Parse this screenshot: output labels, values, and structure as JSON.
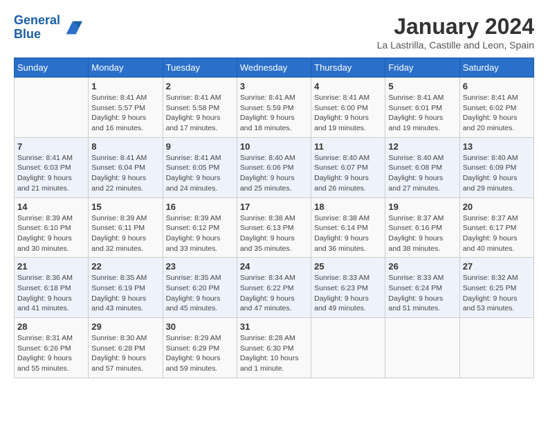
{
  "header": {
    "logo_line1": "General",
    "logo_line2": "Blue",
    "month_year": "January 2024",
    "location": "La Lastrilla, Castille and Leon, Spain"
  },
  "days_of_week": [
    "Sunday",
    "Monday",
    "Tuesday",
    "Wednesday",
    "Thursday",
    "Friday",
    "Saturday"
  ],
  "weeks": [
    [
      {
        "day": "",
        "sunrise": "",
        "sunset": "",
        "daylight": ""
      },
      {
        "day": "1",
        "sunrise": "Sunrise: 8:41 AM",
        "sunset": "Sunset: 5:57 PM",
        "daylight": "Daylight: 9 hours and 16 minutes."
      },
      {
        "day": "2",
        "sunrise": "Sunrise: 8:41 AM",
        "sunset": "Sunset: 5:58 PM",
        "daylight": "Daylight: 9 hours and 17 minutes."
      },
      {
        "day": "3",
        "sunrise": "Sunrise: 8:41 AM",
        "sunset": "Sunset: 5:59 PM",
        "daylight": "Daylight: 9 hours and 18 minutes."
      },
      {
        "day": "4",
        "sunrise": "Sunrise: 8:41 AM",
        "sunset": "Sunset: 6:00 PM",
        "daylight": "Daylight: 9 hours and 19 minutes."
      },
      {
        "day": "5",
        "sunrise": "Sunrise: 8:41 AM",
        "sunset": "Sunset: 6:01 PM",
        "daylight": "Daylight: 9 hours and 19 minutes."
      },
      {
        "day": "6",
        "sunrise": "Sunrise: 8:41 AM",
        "sunset": "Sunset: 6:02 PM",
        "daylight": "Daylight: 9 hours and 20 minutes."
      }
    ],
    [
      {
        "day": "7",
        "sunrise": "Sunrise: 8:41 AM",
        "sunset": "Sunset: 6:03 PM",
        "daylight": "Daylight: 9 hours and 21 minutes."
      },
      {
        "day": "8",
        "sunrise": "Sunrise: 8:41 AM",
        "sunset": "Sunset: 6:04 PM",
        "daylight": "Daylight: 9 hours and 22 minutes."
      },
      {
        "day": "9",
        "sunrise": "Sunrise: 8:41 AM",
        "sunset": "Sunset: 6:05 PM",
        "daylight": "Daylight: 9 hours and 24 minutes."
      },
      {
        "day": "10",
        "sunrise": "Sunrise: 8:40 AM",
        "sunset": "Sunset: 6:06 PM",
        "daylight": "Daylight: 9 hours and 25 minutes."
      },
      {
        "day": "11",
        "sunrise": "Sunrise: 8:40 AM",
        "sunset": "Sunset: 6:07 PM",
        "daylight": "Daylight: 9 hours and 26 minutes."
      },
      {
        "day": "12",
        "sunrise": "Sunrise: 8:40 AM",
        "sunset": "Sunset: 6:08 PM",
        "daylight": "Daylight: 9 hours and 27 minutes."
      },
      {
        "day": "13",
        "sunrise": "Sunrise: 8:40 AM",
        "sunset": "Sunset: 6:09 PM",
        "daylight": "Daylight: 9 hours and 29 minutes."
      }
    ],
    [
      {
        "day": "14",
        "sunrise": "Sunrise: 8:39 AM",
        "sunset": "Sunset: 6:10 PM",
        "daylight": "Daylight: 9 hours and 30 minutes."
      },
      {
        "day": "15",
        "sunrise": "Sunrise: 8:39 AM",
        "sunset": "Sunset: 6:11 PM",
        "daylight": "Daylight: 9 hours and 32 minutes."
      },
      {
        "day": "16",
        "sunrise": "Sunrise: 8:39 AM",
        "sunset": "Sunset: 6:12 PM",
        "daylight": "Daylight: 9 hours and 33 minutes."
      },
      {
        "day": "17",
        "sunrise": "Sunrise: 8:38 AM",
        "sunset": "Sunset: 6:13 PM",
        "daylight": "Daylight: 9 hours and 35 minutes."
      },
      {
        "day": "18",
        "sunrise": "Sunrise: 8:38 AM",
        "sunset": "Sunset: 6:14 PM",
        "daylight": "Daylight: 9 hours and 36 minutes."
      },
      {
        "day": "19",
        "sunrise": "Sunrise: 8:37 AM",
        "sunset": "Sunset: 6:16 PM",
        "daylight": "Daylight: 9 hours and 38 minutes."
      },
      {
        "day": "20",
        "sunrise": "Sunrise: 8:37 AM",
        "sunset": "Sunset: 6:17 PM",
        "daylight": "Daylight: 9 hours and 40 minutes."
      }
    ],
    [
      {
        "day": "21",
        "sunrise": "Sunrise: 8:36 AM",
        "sunset": "Sunset: 6:18 PM",
        "daylight": "Daylight: 9 hours and 41 minutes."
      },
      {
        "day": "22",
        "sunrise": "Sunrise: 8:35 AM",
        "sunset": "Sunset: 6:19 PM",
        "daylight": "Daylight: 9 hours and 43 minutes."
      },
      {
        "day": "23",
        "sunrise": "Sunrise: 8:35 AM",
        "sunset": "Sunset: 6:20 PM",
        "daylight": "Daylight: 9 hours and 45 minutes."
      },
      {
        "day": "24",
        "sunrise": "Sunrise: 8:34 AM",
        "sunset": "Sunset: 6:22 PM",
        "daylight": "Daylight: 9 hours and 47 minutes."
      },
      {
        "day": "25",
        "sunrise": "Sunrise: 8:33 AM",
        "sunset": "Sunset: 6:23 PM",
        "daylight": "Daylight: 9 hours and 49 minutes."
      },
      {
        "day": "26",
        "sunrise": "Sunrise: 8:33 AM",
        "sunset": "Sunset: 6:24 PM",
        "daylight": "Daylight: 9 hours and 51 minutes."
      },
      {
        "day": "27",
        "sunrise": "Sunrise: 8:32 AM",
        "sunset": "Sunset: 6:25 PM",
        "daylight": "Daylight: 9 hours and 53 minutes."
      }
    ],
    [
      {
        "day": "28",
        "sunrise": "Sunrise: 8:31 AM",
        "sunset": "Sunset: 6:26 PM",
        "daylight": "Daylight: 9 hours and 55 minutes."
      },
      {
        "day": "29",
        "sunrise": "Sunrise: 8:30 AM",
        "sunset": "Sunset: 6:28 PM",
        "daylight": "Daylight: 9 hours and 57 minutes."
      },
      {
        "day": "30",
        "sunrise": "Sunrise: 8:29 AM",
        "sunset": "Sunset: 6:29 PM",
        "daylight": "Daylight: 9 hours and 59 minutes."
      },
      {
        "day": "31",
        "sunrise": "Sunrise: 8:28 AM",
        "sunset": "Sunset: 6:30 PM",
        "daylight": "Daylight: 10 hours and 1 minute."
      },
      {
        "day": "",
        "sunrise": "",
        "sunset": "",
        "daylight": ""
      },
      {
        "day": "",
        "sunrise": "",
        "sunset": "",
        "daylight": ""
      },
      {
        "day": "",
        "sunrise": "",
        "sunset": "",
        "daylight": ""
      }
    ]
  ]
}
